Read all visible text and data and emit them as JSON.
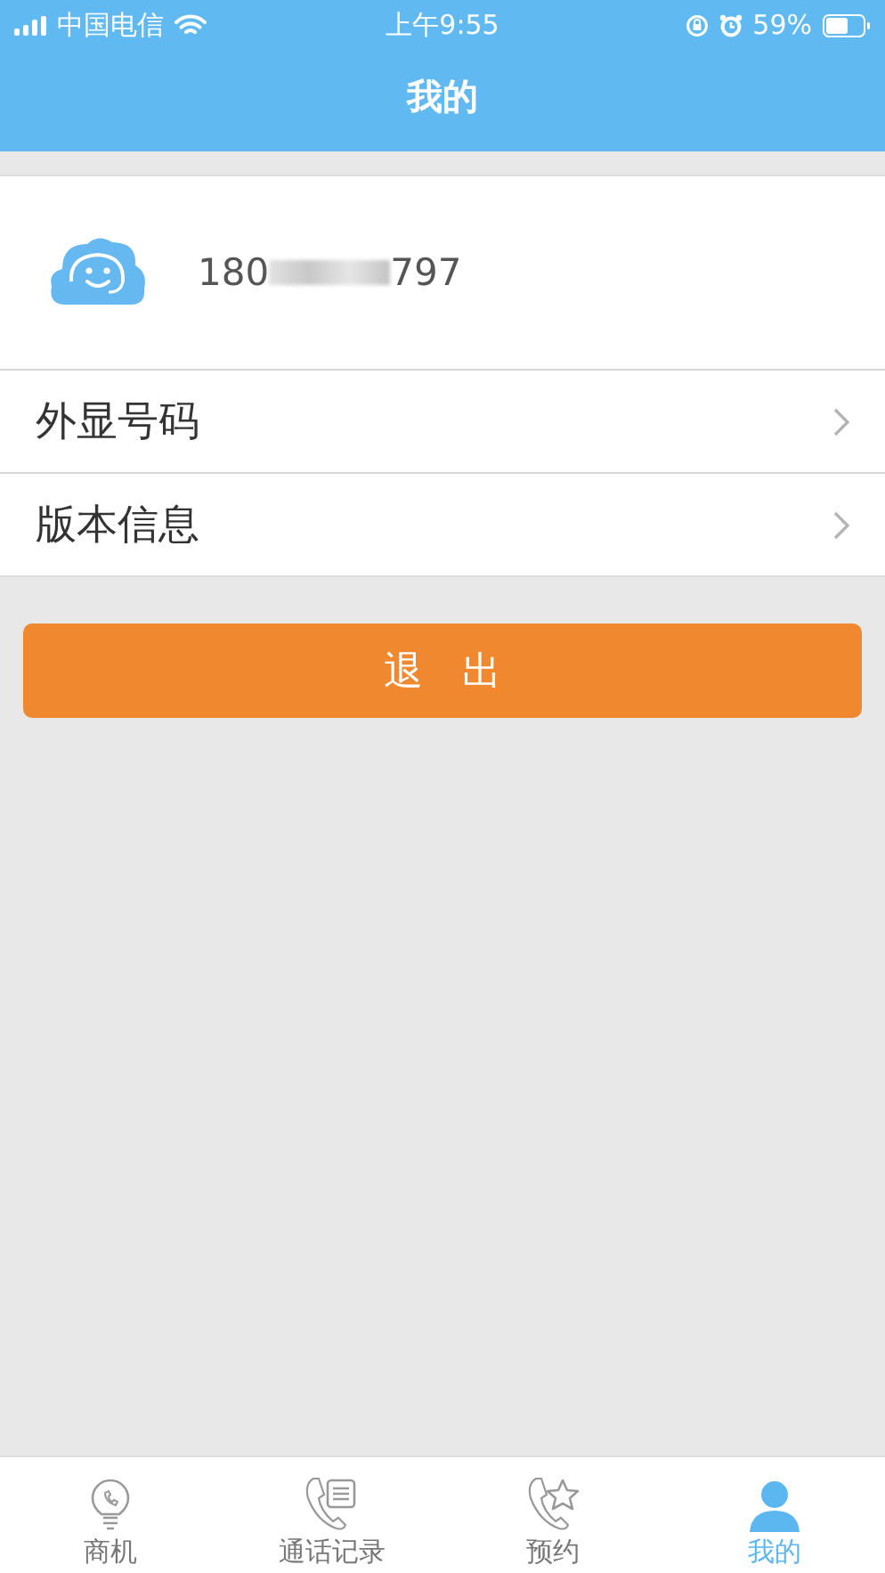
{
  "status_bar": {
    "carrier": "中国电信",
    "time": "上午9:55",
    "battery": "59%"
  },
  "nav_bar": {
    "title": "我的"
  },
  "profile": {
    "phone_start": "180",
    "phone_end": "797",
    "masked": true
  },
  "menu": [
    {
      "label": "外显号码"
    },
    {
      "label": "版本信息"
    }
  ],
  "logout_button": "退　出",
  "tabs": [
    {
      "label": "商机",
      "kind": "bulb",
      "selected": false
    },
    {
      "label": "通话记录",
      "kind": "calllog",
      "selected": false
    },
    {
      "label": "预约",
      "kind": "callstar",
      "selected": false
    },
    {
      "label": "我的",
      "kind": "person",
      "selected": true
    }
  ]
}
